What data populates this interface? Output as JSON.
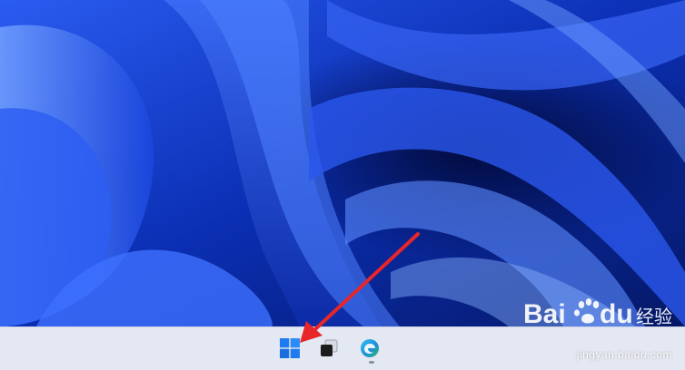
{
  "desktop": {
    "wallpaper": "windows-11-bloom",
    "colors": {
      "deep": "#061a66",
      "mid": "#1a47e0",
      "light": "#5b8dff",
      "highlight": "#9ec1ff"
    }
  },
  "taskbar": {
    "background": "#e4e8f2",
    "icons": [
      {
        "name": "windows-start-icon"
      },
      {
        "name": "task-view-icon"
      },
      {
        "name": "edge-browser-icon"
      }
    ]
  },
  "annotation": {
    "arrow_color": "#e8262a"
  },
  "watermark": {
    "logo_text": "Bai du 经验",
    "url": "jingyan.baidu.com"
  }
}
